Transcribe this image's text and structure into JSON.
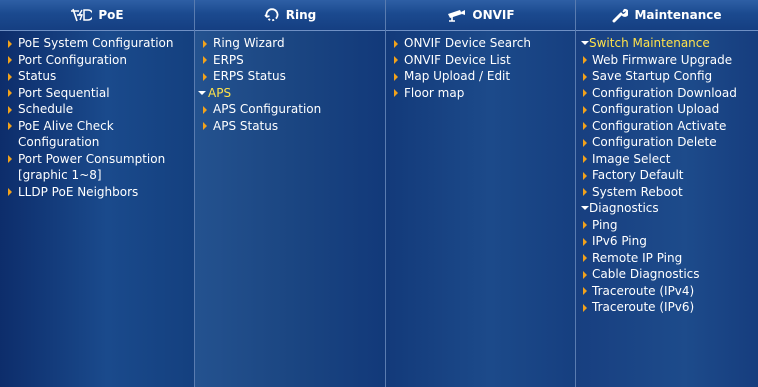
{
  "columns": {
    "poe": {
      "title": "PoE",
      "icon": "poe-icon",
      "items": [
        {
          "label": "PoE System Configuration"
        },
        {
          "label": "Port Configuration"
        },
        {
          "label": "Status"
        },
        {
          "label": "Port Sequential"
        },
        {
          "label": "Schedule"
        },
        {
          "label": "PoE Alive Check Configuration"
        },
        {
          "label": "Port Power Consumption [graphic 1~8]"
        },
        {
          "label": "LLDP PoE Neighbors"
        }
      ]
    },
    "ring": {
      "title": "Ring",
      "icon": "ring-icon",
      "items": [
        {
          "label": "Ring Wizard"
        },
        {
          "label": "ERPS"
        },
        {
          "label": "ERPS Status"
        },
        {
          "label": "APS",
          "state": "expanded"
        },
        {
          "label": "APS Configuration"
        },
        {
          "label": "APS Status"
        }
      ]
    },
    "onvif": {
      "title": "ONVIF",
      "icon": "camera-icon",
      "items": [
        {
          "label": "ONVIF Device Search"
        },
        {
          "label": "ONVIF Device List"
        },
        {
          "label": "Map Upload / Edit"
        },
        {
          "label": "Floor map"
        }
      ]
    },
    "maintenance": {
      "title": "Maintenance",
      "icon": "wrench-icon",
      "items": [
        {
          "label": "Switch Maintenance",
          "state": "expanded"
        },
        {
          "label": "Web Firmware Upgrade"
        },
        {
          "label": "Save Startup Config"
        },
        {
          "label": "Configuration Download"
        },
        {
          "label": "Configuration Upload"
        },
        {
          "label": "Configuration Activate"
        },
        {
          "label": "Configuration Delete"
        },
        {
          "label": "Image Select"
        },
        {
          "label": "Factory Default"
        },
        {
          "label": "System Reboot"
        },
        {
          "label": "Diagnostics",
          "state": "expanded-white"
        },
        {
          "label": "Ping"
        },
        {
          "label": "IPv6 Ping"
        },
        {
          "label": "Remote IP Ping"
        },
        {
          "label": "Cable Diagnostics"
        },
        {
          "label": "Traceroute (IPv4)"
        },
        {
          "label": "Traceroute (IPv6)"
        }
      ]
    }
  },
  "colors": {
    "active_text": "#ffe24a",
    "bullet": "#f2a21b",
    "text": "#ffffff"
  }
}
